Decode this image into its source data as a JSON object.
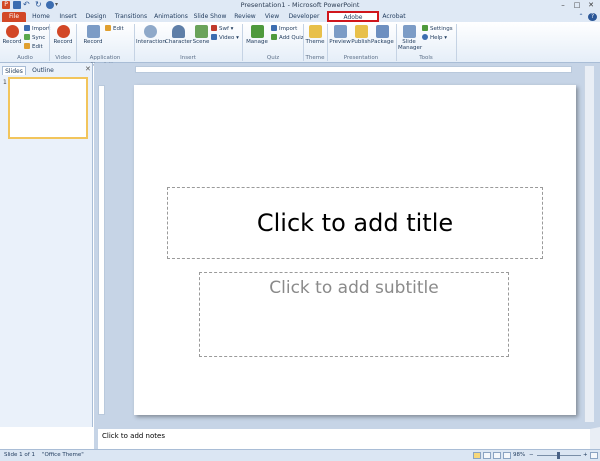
{
  "window": {
    "title": "Presentation1 - Microsoft PowerPoint",
    "app_icon": "P",
    "controls": [
      "–",
      "□",
      "✕"
    ]
  },
  "tabs": [
    "File",
    "Home",
    "Insert",
    "Design",
    "Transitions",
    "Animations",
    "Slide Show",
    "Review",
    "View",
    "Developer",
    "Adobe Presenter",
    "Acrobat"
  ],
  "ribbon": {
    "audio": {
      "record": "Record",
      "import": "Import",
      "sync": "Sync",
      "edit": "Edit",
      "group": "Audio"
    },
    "video": {
      "record": "Record",
      "group": "Video"
    },
    "appsim": {
      "record": "Record",
      "edit": "Edit",
      "group": "Application Simulation"
    },
    "insert": {
      "interaction": "Interaction",
      "character": "Character",
      "scene": "Scene",
      "swf": "Swf",
      "video": "Video",
      "group": "Insert"
    },
    "quiz": {
      "manage": "Manage",
      "import": "Import",
      "add_quiz": "Add Quiz",
      "group": "Quiz"
    },
    "theme": {
      "theme": "Theme",
      "group": "Theme"
    },
    "presentation": {
      "preview": "Preview",
      "publish": "Publish",
      "package": "Package",
      "group": "Presentation"
    },
    "tools": {
      "slide_manager_1": "Slide",
      "slide_manager_2": "Manager",
      "settings": "Settings",
      "help": "Help",
      "group": "Tools"
    }
  },
  "colors": {
    "accent_file": "#d24726",
    "highlight": "#d0161c",
    "ribbon_bg": "#dfe9f5"
  },
  "left_pane": {
    "tab_slides": "Slides",
    "tab_outline": "Outline",
    "close": "✕",
    "slide_number": "1"
  },
  "slide": {
    "title_placeholder": "Click to add title",
    "subtitle_placeholder": "Click to add subtitle"
  },
  "notes": {
    "placeholder": "Click to add notes"
  },
  "status": {
    "slide_info": "Slide 1 of 1",
    "theme": "\"Office Theme\"",
    "zoom": "98%"
  }
}
